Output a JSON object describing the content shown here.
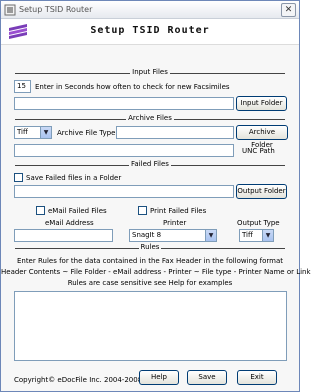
{
  "window": {
    "title": "Setup TSID Router",
    "close_glyph": "✕"
  },
  "banner": {
    "title": "Setup TSID Router",
    "logo_icon": "edocfile-logo-icon"
  },
  "sections": {
    "input_files": "Input Files",
    "archive_files": "Archive Files",
    "failed_files": "Failed Files",
    "rules": "Rules"
  },
  "input": {
    "interval_value": "15",
    "interval_label": "Enter in Seconds how often to check for new Facsimiles",
    "folder_value": "",
    "folder_button": "Input Folder"
  },
  "archive": {
    "type_value": "Tiff",
    "type_label": "Archive File Type",
    "folder_value": "",
    "folder_button": "Archive Folder",
    "unc_value": "",
    "unc_label": "UNC Path"
  },
  "failed": {
    "save_checkbox_label": "Save Failed files in a Folder",
    "save_checked": false,
    "folder_value": "",
    "folder_button": "Output Folder"
  },
  "notify": {
    "email_checkbox_label": "eMail Failed Files",
    "email_checked": false,
    "print_checkbox_label": "Print Failed Files",
    "print_checked": false,
    "email_label": "eMail Address",
    "email_value": "",
    "printer_label": "Printer",
    "printer_value": "SnagIt 8",
    "output_type_label": "Output Type",
    "output_type_value": "Tiff"
  },
  "rules": {
    "line1": "Enter Rules for the data contained in the Fax Header in the following format",
    "line2": "Header Contents ~ File Folder - eMail address - Printer ~ File type - Printer Name or Link",
    "line3": "Rules are case sensitive see Help for examples",
    "text_value": ""
  },
  "footer": {
    "copyright": "Copyright© eDocFile Inc. 2004-2008",
    "help_button": "Help",
    "save_button": "Save",
    "exit_button": "Exit"
  }
}
